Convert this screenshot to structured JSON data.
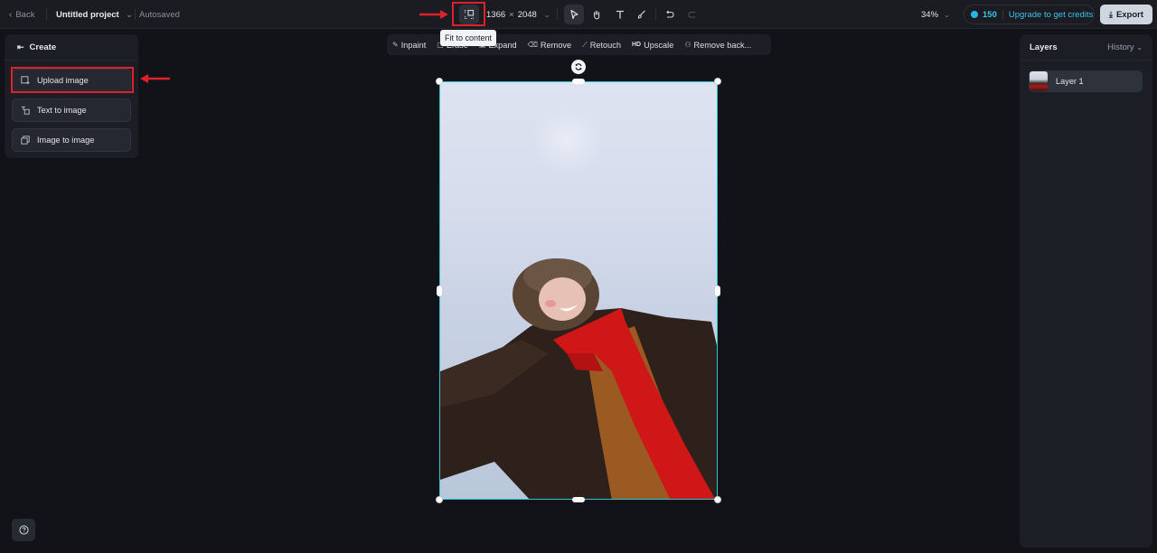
{
  "topbar": {
    "back_label": "Back",
    "project_title": "Untitled project",
    "autosave_status": "Autosaved",
    "fit_tooltip": "Fit to content",
    "canvas_width": "1366",
    "canvas_times": "×",
    "canvas_height": "2048",
    "zoom_level": "34%",
    "credits_count": "150",
    "upgrade_label": "Upgrade to get credits",
    "export_label": "Export"
  },
  "edit_tools": [
    {
      "label": "Inpaint",
      "icon": "brush-icon"
    },
    {
      "label": "Erase",
      "icon": "eraser-icon"
    },
    {
      "label": "Expand",
      "icon": "expand-icon"
    },
    {
      "label": "Remove",
      "icon": "eraser-icon"
    },
    {
      "label": "Retouch",
      "icon": "wand-icon"
    },
    {
      "label": "Upscale",
      "icon": "hd-icon",
      "prefix": "HD"
    },
    {
      "label": "Remove back...",
      "icon": "people-icon"
    }
  ],
  "left_panel": {
    "title": "Create",
    "items": [
      {
        "label": "Upload image"
      },
      {
        "label": "Text to image"
      },
      {
        "label": "Image to image"
      }
    ]
  },
  "right_panel": {
    "layers_title": "Layers",
    "history_label": "History",
    "layers": [
      {
        "name": "Layer 1"
      }
    ]
  },
  "colors": {
    "accent": "#3dc2ea",
    "selection": "#2ec8d0",
    "annotation": "#e0202a"
  }
}
